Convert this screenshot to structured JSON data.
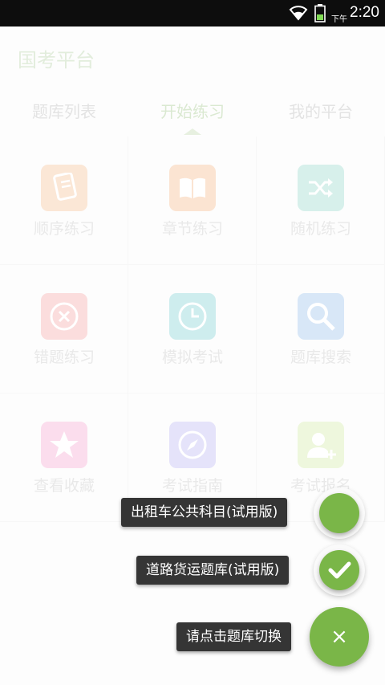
{
  "status_bar": {
    "ampm": "下午",
    "time": "2:20"
  },
  "app": {
    "title": "国考平台"
  },
  "tabs": [
    {
      "label": "题库列表"
    },
    {
      "label": "开始练习"
    },
    {
      "label": "我的平台"
    }
  ],
  "grid": [
    {
      "label": "顺序练习",
      "icon": "document-list-icon",
      "color": "#fbe6d4"
    },
    {
      "label": "章节练习",
      "icon": "open-book-icon",
      "color": "#fbe3d0"
    },
    {
      "label": "随机练习",
      "icon": "shuffle-icon",
      "color": "#d5f0ea"
    },
    {
      "label": "错题练习",
      "icon": "close-circle-icon",
      "color": "#fbdcdc"
    },
    {
      "label": "模拟考试",
      "icon": "clock-icon",
      "color": "#ccecee"
    },
    {
      "label": "题库搜索",
      "icon": "search-icon",
      "color": "#d6e6f7"
    },
    {
      "label": "查看收藏",
      "icon": "star-icon",
      "color": "#fbdcec"
    },
    {
      "label": "考试指南",
      "icon": "compass-icon",
      "color": "#e4e2fa"
    },
    {
      "label": "考试报名",
      "icon": "add-user-icon",
      "color": "#eef7dc"
    }
  ],
  "fab_menu": {
    "items": [
      {
        "label": "出租车公共科目(试用版)",
        "icon": ""
      },
      {
        "label": "道路货运题库(试用版)",
        "icon": "check-icon"
      }
    ],
    "main_label": "请点击题库切换",
    "main_icon": "close-icon",
    "main_glyph": "×",
    "accent_color": "#7ab648"
  }
}
